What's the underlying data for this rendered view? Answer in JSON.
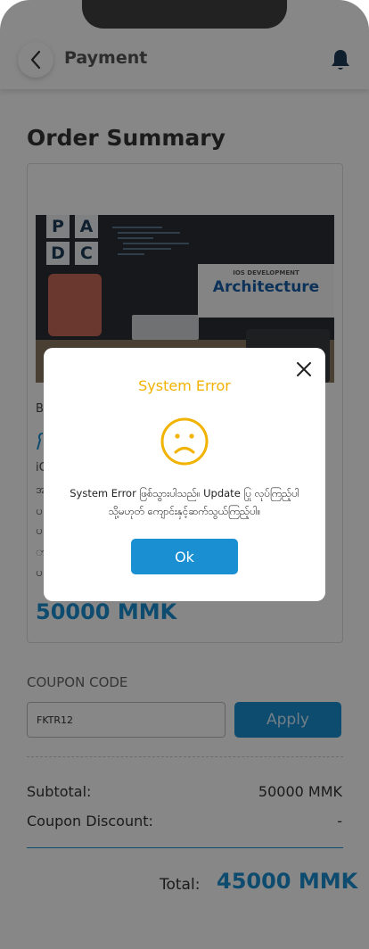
{
  "header": {
    "title": "Payment"
  },
  "order": {
    "title": "Order Summary",
    "image": {
      "letters": [
        "P",
        "A",
        "D",
        "C"
      ],
      "subtitle": "IOS DEVELOPMENT",
      "main": "Architecture"
    },
    "line_1": "B",
    "line_2": "iC",
    "line_3": "အ",
    "line_4": "ပ",
    "line_5": "ပ",
    "line_6": "ာ",
    "line_7": "ပ",
    "price": "50000 MMK"
  },
  "coupon": {
    "label": "COUPON CODE",
    "value": "FKTR12",
    "apply_label": "Apply"
  },
  "summary": {
    "subtotal_label": "Subtotal:",
    "subtotal_value": "50000 MMK",
    "discount_label": "Coupon Discount:",
    "discount_value": "-",
    "total_label": "Total:",
    "total_value": "45000 MMK"
  },
  "modal": {
    "title": "System Error",
    "message_line_1": "System Error ဖြစ်သွားပါသည်။ Update ပြု လုပ်ကြည့်ပါ",
    "message_line_2": "သို့မဟုတ် ကျောင်းနှင့်ဆက်သွယ်ကြည့်ပါ။",
    "ok_label": "Ok"
  },
  "colors": {
    "accent": "#1a8fd2",
    "warning": "#f2b200",
    "text": "#333333"
  },
  "icons": [
    "chevron-left-icon",
    "bell-icon",
    "close-icon",
    "sad-face-icon"
  ]
}
